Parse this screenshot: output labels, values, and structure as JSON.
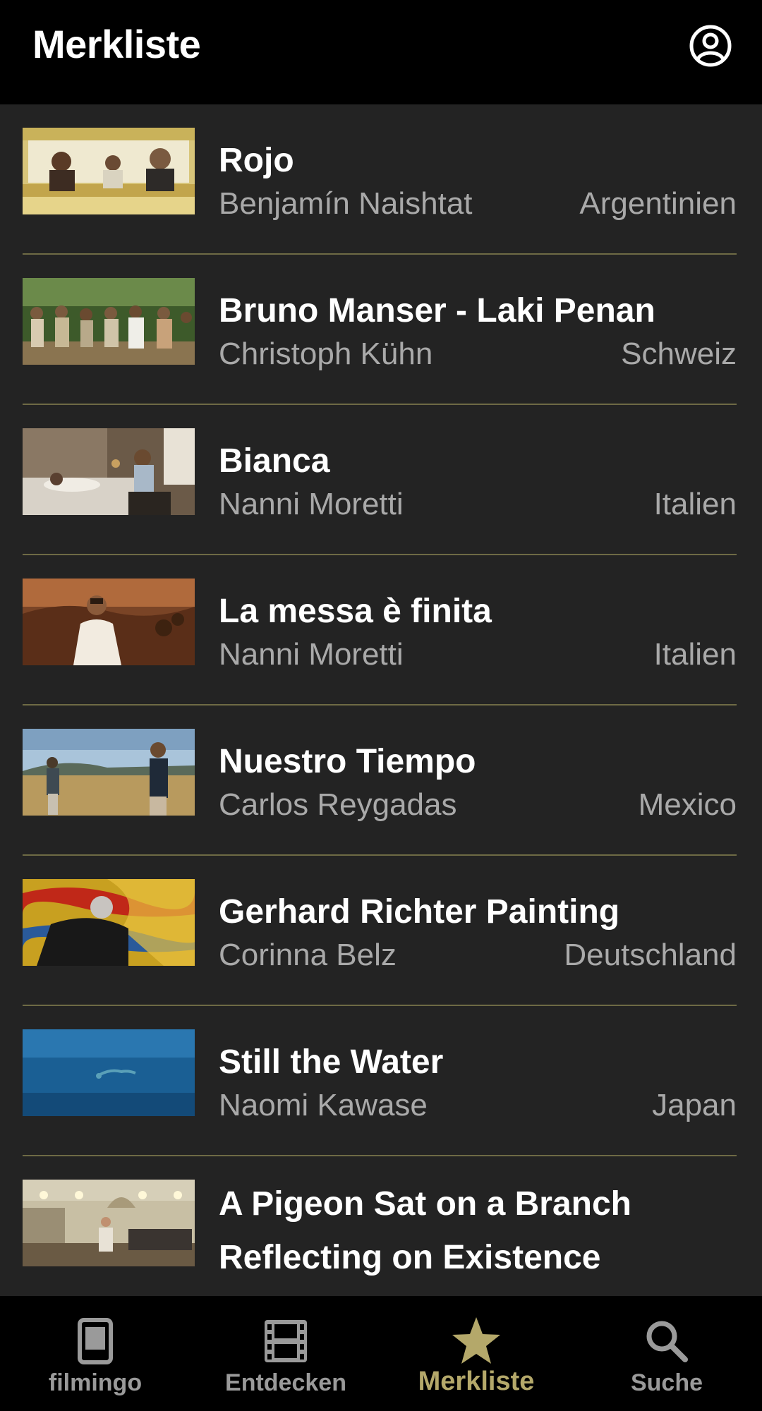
{
  "header": {
    "title": "Merkliste",
    "account_icon": "account-circle-icon"
  },
  "colors": {
    "background": "#232323",
    "bar_background": "#000000",
    "divider": "#6e6a45",
    "accent": "#b4a86a",
    "secondary_text": "#a9a9a9",
    "inactive_nav": "#9a9a9a"
  },
  "films": [
    {
      "title": "Rojo",
      "director": "Benjamín Naishtat",
      "country": "Argentinien"
    },
    {
      "title": "Bruno Manser - Laki Penan",
      "director": "Christoph Kühn",
      "country": "Schweiz"
    },
    {
      "title": "Bianca",
      "director": "Nanni Moretti",
      "country": "Italien"
    },
    {
      "title": "La messa è finita",
      "director": "Nanni Moretti",
      "country": "Italien"
    },
    {
      "title": "Nuestro Tiempo",
      "director": "Carlos Reygadas",
      "country": "Mexico"
    },
    {
      "title": "Gerhard Richter Painting",
      "director": "Corinna Belz",
      "country": "Deutschland"
    },
    {
      "title": "Still the Water",
      "director": "Naomi Kawase",
      "country": "Japan"
    },
    {
      "title_line1": "A Pigeon Sat on a Branch",
      "title_line2": "Reflecting on Existence"
    }
  ],
  "nav": [
    {
      "label": "filmingo",
      "icon": "tablet-icon"
    },
    {
      "label": "Entdecken",
      "icon": "film-strip-icon"
    },
    {
      "label": "Merkliste",
      "icon": "star-icon",
      "active": true
    },
    {
      "label": "Suche",
      "icon": "search-icon"
    }
  ]
}
